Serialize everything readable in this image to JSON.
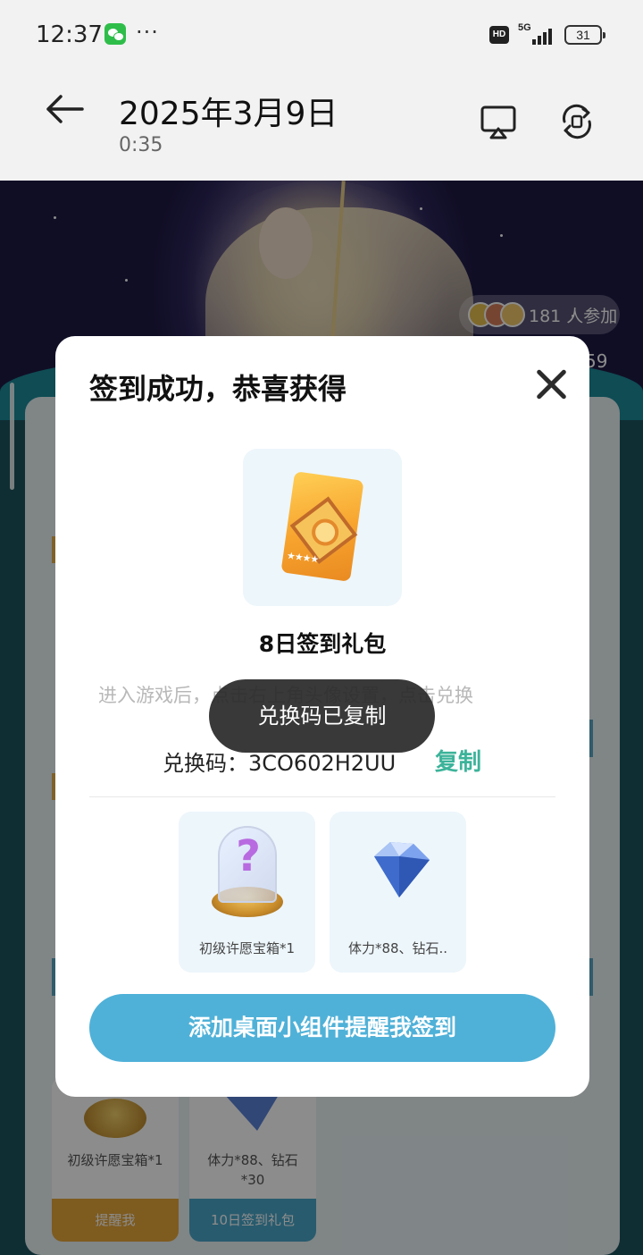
{
  "status_bar": {
    "time": "12:37",
    "dots": "···",
    "hd": "HD",
    "network": "5G",
    "battery": "31"
  },
  "header": {
    "title": "2025年3月9日",
    "subtitle": "0:35"
  },
  "background": {
    "participants": "181 人参加",
    "partial_count": "59",
    "cards": [
      {
        "caption": "初级许愿宝箱*1",
        "button": "提醒我"
      },
      {
        "caption": "体力*88、钻石\n*30",
        "button": "10日签到礼包"
      }
    ]
  },
  "modal": {
    "title": "签到成功，恭喜获得",
    "gift_name": "8日签到礼包",
    "instruction": "进入游戏后，点击右上角头像设置，点击兑换",
    "code_label": "兑换码：",
    "code": "3CO602H2UU",
    "copy_label": "复制",
    "items": [
      {
        "name": "初级许愿宝箱*1",
        "icon": "wish-box-icon"
      },
      {
        "name": "体力*88、钻石..",
        "icon": "diamond-icon"
      }
    ],
    "cta_label": "添加桌面小组件提醒我签到"
  },
  "toast": {
    "text": "兑换码已复制"
  },
  "colors": {
    "accent": "#4fb1d8",
    "copy": "#3cb39a",
    "toast_bg": "#282828"
  }
}
